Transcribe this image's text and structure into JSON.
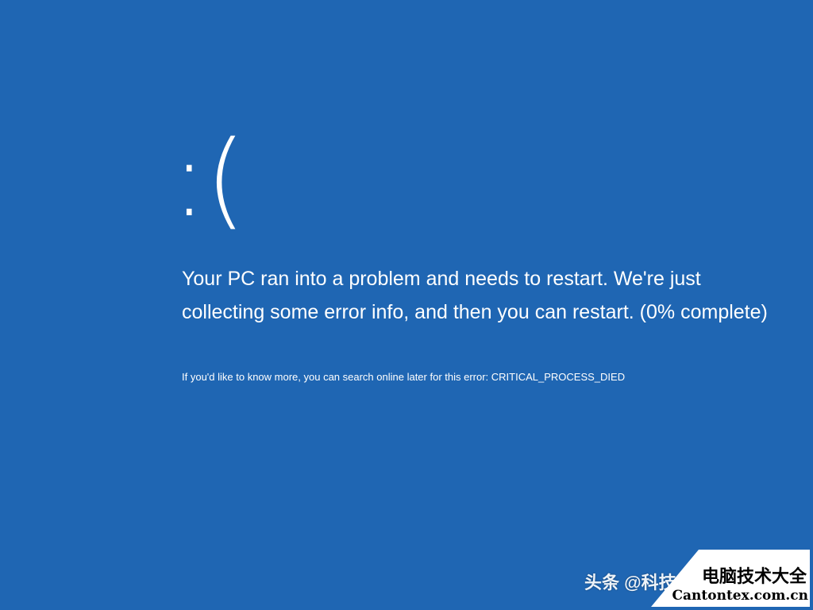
{
  "screen": {
    "background_color": "#1f66b3",
    "text_color": "#ffffff"
  },
  "face": ":(",
  "message": "Your PC ran into a problem and needs to restart. We're just collecting some error info, and then you can restart. (0% complete)",
  "progress_percent": 0,
  "detail": "If you'd like to know more, you can search online later for this error: CRITICAL_PROCESS_DIED",
  "watermark": {
    "toutiao_text": "头条 @科技",
    "badge_title": "电脑技术大全",
    "badge_url": "Cantontex.com.cn"
  }
}
